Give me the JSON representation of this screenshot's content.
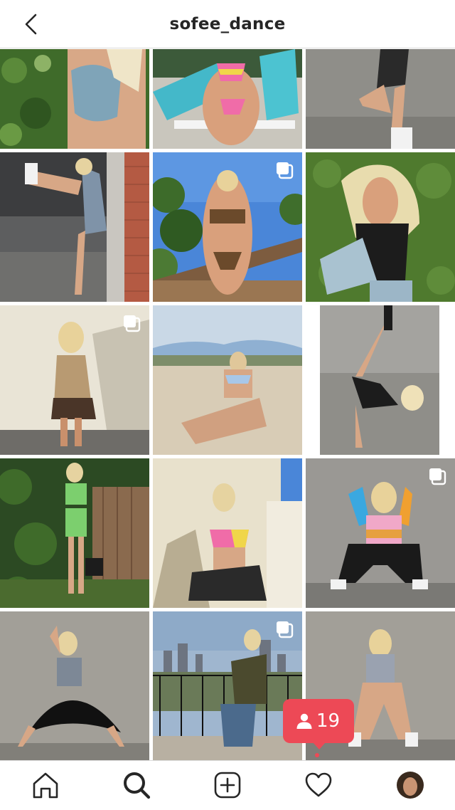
{
  "header": {
    "title": "sofee_dance",
    "back_icon": "chevron-left-icon"
  },
  "grid": {
    "rows": 5,
    "columns": 3,
    "multi_photo_tiles": [
      5,
      7,
      12,
      14
    ],
    "colors": {
      "grass": "#3f6b2a",
      "concrete": "#9a9894",
      "sky": "#4a86d8",
      "sand": "#d8ccb6",
      "wall": "#e9e4d6"
    }
  },
  "notification_badge": {
    "count": "19",
    "icon": "person-icon",
    "color": "#ed4956"
  },
  "nav": {
    "items": [
      "home-icon",
      "search-icon",
      "new-post-icon",
      "heart-icon",
      "profile-avatar"
    ],
    "activity_dot_color": "#ed4956"
  }
}
